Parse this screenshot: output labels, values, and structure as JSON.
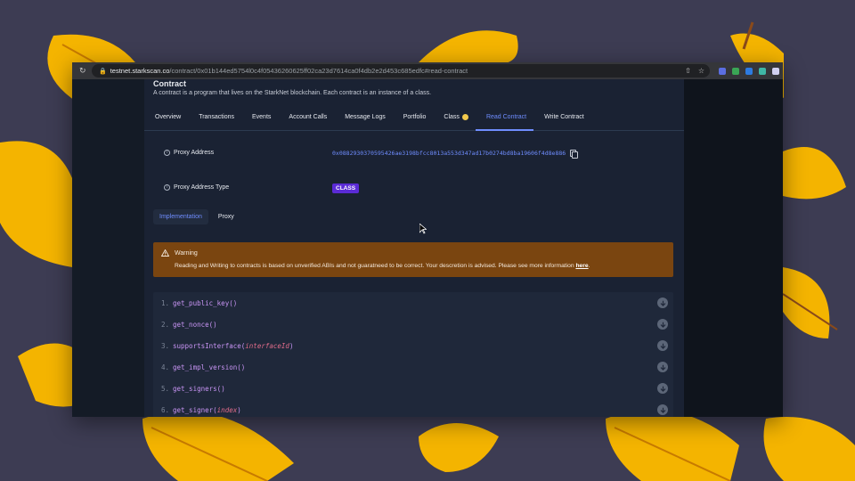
{
  "browser": {
    "url_host": "testnet.starkscan.co",
    "url_path": "/contract/0x01b144ed5754l0c4f05436260625ff02ca23d7614ca0f4db2e2d453c685edfc#read-contract"
  },
  "contract": {
    "title": "Contract",
    "description": "A contract is a program that lives on the StarkNet blockchain. Each contract is an instance of a class."
  },
  "tabs": [
    {
      "label": "Overview"
    },
    {
      "label": "Transactions"
    },
    {
      "label": "Events"
    },
    {
      "label": "Account Calls"
    },
    {
      "label": "Message Logs"
    },
    {
      "label": "Portfolio"
    },
    {
      "label": "Class"
    },
    {
      "label": "Read Contract"
    },
    {
      "label": "Write Contract"
    }
  ],
  "active_tab": "Read Contract",
  "proxy": {
    "address_label": "Proxy Address",
    "address_value": "0x0882930370595426ae3198bfcc8013a553d347ad17b0274bd8ba19606f4d8e886",
    "type_label": "Proxy Address Type",
    "type_value": "CLASS"
  },
  "subtabs": [
    {
      "label": "Implementation"
    },
    {
      "label": "Proxy"
    }
  ],
  "warning": {
    "title": "Warning",
    "text": "Reading and Writing to contracts is based on unverified ABIs and not guaratneed to be correct. Your descretion is advised. Please see more information ",
    "link": "here",
    "end": "."
  },
  "functions": [
    {
      "num": "1.",
      "name": "get_public_key",
      "arg": ""
    },
    {
      "num": "2.",
      "name": "get_nonce",
      "arg": ""
    },
    {
      "num": "3.",
      "name": "supportsInterface",
      "arg": "interfaceId"
    },
    {
      "num": "4.",
      "name": "get_impl_version",
      "arg": ""
    },
    {
      "num": "5.",
      "name": "get_signers",
      "arg": ""
    },
    {
      "num": "6.",
      "name": "get_signer",
      "arg": "index"
    }
  ],
  "colors": {
    "accent": "#6f8dff",
    "warning_bg": "#7a4510",
    "badge": "#5b2bd6",
    "function_name": "#c995f5",
    "function_arg": "#e06c8a",
    "wallpaper": "#3d3c53",
    "leaf": "#f4b400"
  }
}
